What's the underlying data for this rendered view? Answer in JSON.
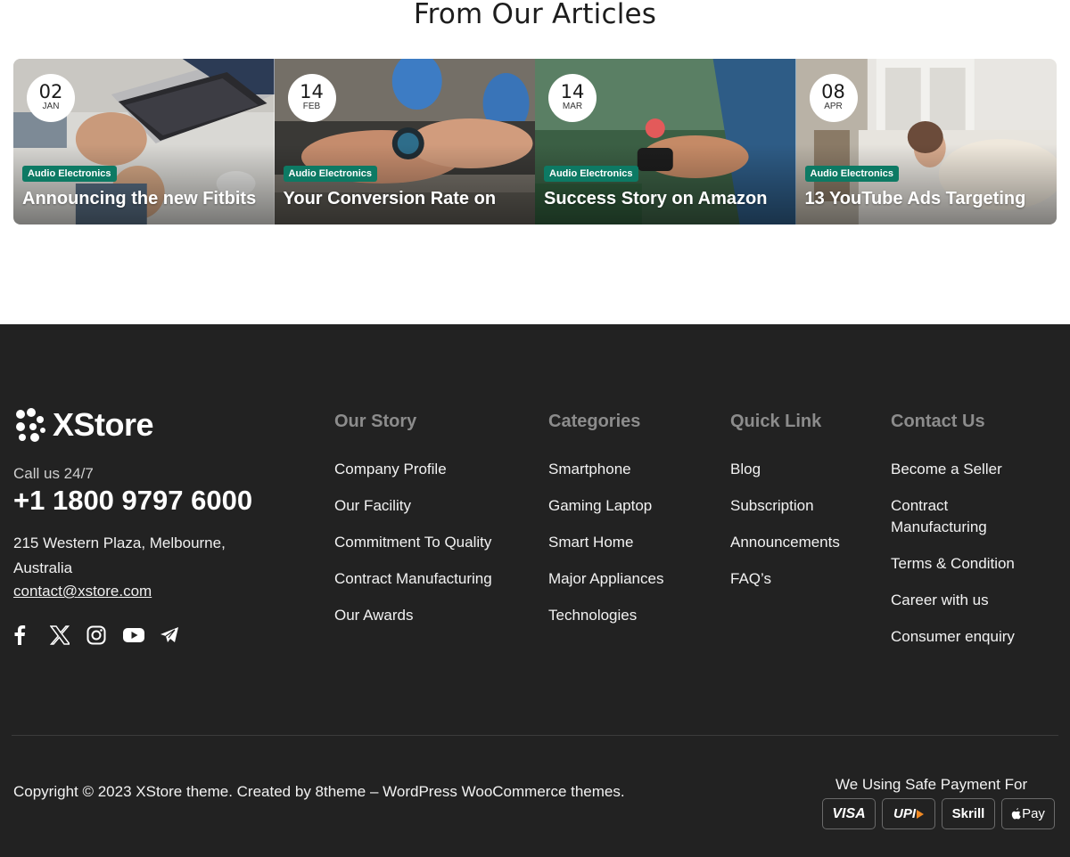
{
  "articles": {
    "title": "From Our Articles",
    "cards": [
      {
        "day": "02",
        "month": "JAN",
        "tag": "Audio Electronics",
        "title": "Announcing the new Fitbits"
      },
      {
        "day": "14",
        "month": "FEB",
        "tag": "Audio Electronics",
        "title": "Your Conversion Rate on"
      },
      {
        "day": "14",
        "month": "MAR",
        "tag": "Audio Electronics",
        "title": "Success Story on Amazon"
      },
      {
        "day": "08",
        "month": "APR",
        "tag": "Audio Electronics",
        "title": "13 YouTube Ads Targeting"
      }
    ]
  },
  "footer": {
    "brand": "XStore",
    "call_label": "Call us 24/7",
    "phone": "+1 1800 9797 6000",
    "address": "215 Western Plaza, Melbourne, Australia",
    "email": "contact@xstore.com",
    "socials": [
      "facebook-icon",
      "x-icon",
      "instagram-icon",
      "youtube-icon",
      "telegram-icon"
    ],
    "columns": [
      {
        "heading": "Our Story",
        "items": [
          "Company Profile",
          "Our Facility",
          "Commitment To Quality",
          "Contract Manufacturing",
          "Our Awards"
        ]
      },
      {
        "heading": "Categories",
        "items": [
          "Smartphone",
          "Gaming Laptop",
          "Smart Home",
          "Major Appliances",
          "Technologies"
        ]
      },
      {
        "heading": "Quick Link",
        "items": [
          "Blog",
          "Subscription",
          "Announcements",
          "FAQ’s"
        ]
      },
      {
        "heading": "Contact Us",
        "items": [
          "Become a Seller",
          "Contract Manufacturing",
          "Terms & Condition",
          "Career with us",
          "Consumer enquiry"
        ]
      }
    ],
    "copyright": "Copyright © 2023 XStore theme. Created by 8theme – WordPress WooCommerce themes.",
    "payment_label": "We Using Safe Payment For",
    "payments": [
      "VISA",
      "UPI",
      "Skrill",
      "Pay"
    ]
  },
  "colors": {
    "footer_bg": "#222222",
    "tag_bg": "#0d7a64",
    "heading_muted": "#8c8c8c"
  }
}
